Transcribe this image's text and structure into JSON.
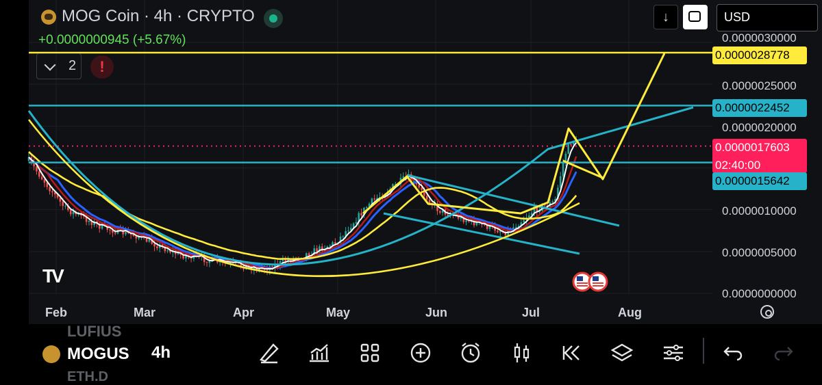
{
  "header": {
    "title": "MOG Coin · 4h · CRYPTO",
    "change": "+0.0000000945 (+5.67%)",
    "indicator_count": "2",
    "warning_glyph": "!",
    "currency": "USD",
    "download_glyph": "↓"
  },
  "price_labels": {
    "resistance_top": "0.0000028778",
    "resistance_mid": "0.0000022452",
    "current_price": "0.0000017603",
    "countdown": "02:40:00",
    "support": "0.0000015642"
  },
  "colors": {
    "yellow": "#ffeb3b",
    "cyan": "#26b3c9",
    "pink": "#ff1f5a",
    "up": "#26a69a",
    "down": "#ef5350"
  },
  "chart_data": {
    "type": "line",
    "symbol": "MOG Coin",
    "interval": "4h",
    "y_ticks": [
      "0.0000030000",
      "0.0000025000",
      "0.0000020000",
      "0.0000010000",
      "0.0000005000",
      "0.0000000000"
    ],
    "x_ticks": [
      "Feb",
      "Mar",
      "Apr",
      "May",
      "Jun",
      "Jul",
      "Aug"
    ],
    "ylim": [
      0,
      3e-06
    ],
    "horizontal_levels": [
      2.8778e-06,
      2.2452e-06,
      1.7603e-06,
      1.5642e-06
    ],
    "price_path": {
      "x": [
        "Jan 25",
        "Feb 5",
        "Feb 15",
        "Feb 25",
        "Mar 10",
        "Mar 25",
        "Apr 10",
        "Apr 25",
        "May 5",
        "May 15",
        "May 23",
        "Jun 1",
        "Jun 10",
        "Jun 20",
        "Jun 28",
        "Jul 5",
        "Jul 10",
        "Jul 12",
        "Jul 14",
        "Jul 16"
      ],
      "y": [
        1.7e-06,
        1.3e-06,
        1e-06,
        8.5e-07,
        6.5e-07,
        4.5e-07,
        3.5e-07,
        4e-07,
        5.5e-07,
        8e-07,
        1.1e-06,
        1.15e-06,
        9e-07,
        9.5e-07,
        8.5e-07,
        1e-06,
        1.1e-06,
        1.5e-06,
        1.9e-06,
        1.7603e-06
      ]
    }
  },
  "bottom_bar": {
    "symbol": "MOGUS",
    "symbol_above": "LUFIUS",
    "symbol_below": "ETH.D",
    "interval": "4h"
  }
}
